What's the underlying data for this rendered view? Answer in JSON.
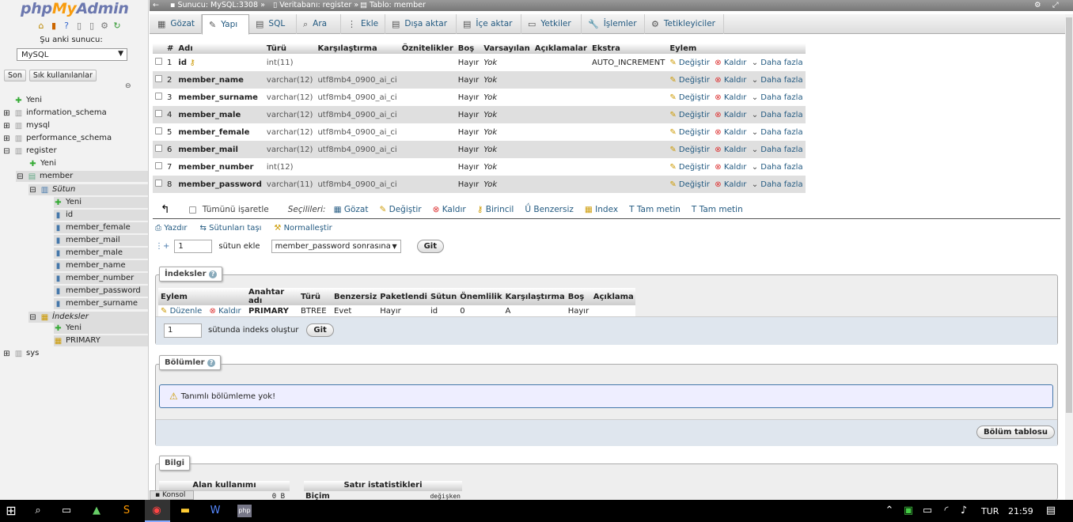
{
  "sidebar": {
    "logo_php": "php",
    "logo_my": "My",
    "logo_admin": "Admin",
    "server_label": "Şu anki sunucu:",
    "server_select": "MySQL",
    "recent_btn": "Son",
    "fav_btn": "Sık kullanılanlar",
    "tree": [
      {
        "label": "Yeni"
      },
      {
        "label": "information_schema"
      },
      {
        "label": "mysql"
      },
      {
        "label": "performance_schema"
      },
      {
        "label": "register"
      },
      {
        "label": "Yeni"
      },
      {
        "label": "member"
      },
      {
        "label": "Sütun"
      },
      {
        "label": "Yeni"
      },
      {
        "label": "id"
      },
      {
        "label": "member_female"
      },
      {
        "label": "member_mail"
      },
      {
        "label": "member_male"
      },
      {
        "label": "member_name"
      },
      {
        "label": "member_number"
      },
      {
        "label": "member_password"
      },
      {
        "label": "member_surname"
      },
      {
        "label": "İndeksler"
      },
      {
        "label": "Yeni"
      },
      {
        "label": "PRIMARY"
      },
      {
        "label": "sys"
      }
    ]
  },
  "breadcrumb": {
    "server": "Sunucu: MySQL:3308",
    "sep1": "»",
    "db": "Veritabanı: register",
    "sep2": "»",
    "table": "Tablo: member"
  },
  "tabs": [
    {
      "label": "Gözat",
      "icon": "browse-icon"
    },
    {
      "label": "Yapı",
      "icon": "structure-icon"
    },
    {
      "label": "SQL",
      "icon": "sql-icon"
    },
    {
      "label": "Ara",
      "icon": "search-icon"
    },
    {
      "label": "Ekle",
      "icon": "insert-icon"
    },
    {
      "label": "Dışa aktar",
      "icon": "export-icon"
    },
    {
      "label": "İçe aktar",
      "icon": "import-icon"
    },
    {
      "label": "Yetkiler",
      "icon": "privileges-icon"
    },
    {
      "label": "İşlemler",
      "icon": "operations-icon"
    },
    {
      "label": "Tetikleyiciler",
      "icon": "triggers-icon"
    }
  ],
  "structure": {
    "headers": [
      "#",
      "Adı",
      "Türü",
      "Karşılaştırma",
      "Öznitelikler",
      "Boş",
      "Varsayılan",
      "Açıklamalar",
      "Ekstra",
      "Eylem"
    ],
    "rows": [
      {
        "num": "1",
        "name": "id",
        "type": "int(11)",
        "collation": "",
        "null": "Hayır",
        "default": "Yok",
        "extra": "AUTO_INCREMENT"
      },
      {
        "num": "2",
        "name": "member_name",
        "type": "varchar(12)",
        "collation": "utf8mb4_0900_ai_ci",
        "null": "Hayır",
        "default": "Yok",
        "extra": ""
      },
      {
        "num": "3",
        "name": "member_surname",
        "type": "varchar(12)",
        "collation": "utf8mb4_0900_ai_ci",
        "null": "Hayır",
        "default": "Yok",
        "extra": ""
      },
      {
        "num": "4",
        "name": "member_male",
        "type": "varchar(12)",
        "collation": "utf8mb4_0900_ai_ci",
        "null": "Hayır",
        "default": "Yok",
        "extra": ""
      },
      {
        "num": "5",
        "name": "member_female",
        "type": "varchar(12)",
        "collation": "utf8mb4_0900_ai_ci",
        "null": "Hayır",
        "default": "Yok",
        "extra": ""
      },
      {
        "num": "6",
        "name": "member_mail",
        "type": "varchar(12)",
        "collation": "utf8mb4_0900_ai_ci",
        "null": "Hayır",
        "default": "Yok",
        "extra": ""
      },
      {
        "num": "7",
        "name": "member_number",
        "type": "int(12)",
        "collation": "",
        "null": "Hayır",
        "default": "Yok",
        "extra": ""
      },
      {
        "num": "8",
        "name": "member_password",
        "type": "varchar(11)",
        "collation": "utf8mb4_0900_ai_ci",
        "null": "Hayır",
        "default": "Yok",
        "extra": ""
      }
    ],
    "action_change": "Değiştir",
    "action_drop": "Kaldır",
    "action_more": "Daha fazla"
  },
  "bulk": {
    "check_all": "Tümünü işaretle",
    "selected": "Seçilileri:",
    "browse": "Gözat",
    "change": "Değiştir",
    "drop": "Kaldır",
    "primary": "Birincil",
    "unique": "Benzersiz",
    "index": "Index",
    "fulltext1": "Tam metin",
    "fulltext2": "Tam metin"
  },
  "tools": {
    "print": "Yazdır",
    "move": "Sütunları taşı",
    "normalize": "Normalleştir"
  },
  "add_col": {
    "count": "1",
    "label": "sütun ekle",
    "position": "member_password sonrasına",
    "go": "Git"
  },
  "indexes": {
    "title": "İndeksler",
    "headers": [
      "Eylem",
      "Anahtar adı",
      "Türü",
      "Benzersiz",
      "Paketlendi",
      "Sütun",
      "Önemlilik",
      "Karşılaştırma",
      "Boş",
      "Açıklama"
    ],
    "row": {
      "edit": "Düzenle",
      "drop": "Kaldır",
      "key": "PRIMARY",
      "type": "BTREE",
      "unique": "Evet",
      "packed": "Hayır",
      "column": "id",
      "cardinality": "0",
      "collation": "A",
      "null": "Hayır",
      "comment": ""
    },
    "create_count": "1",
    "create_label": "sütunda indeks oluştur",
    "go": "Git"
  },
  "partitions": {
    "title": "Bölümler",
    "none": "Tanımlı bölümleme yok!",
    "btn": "Bölüm tablosu"
  },
  "info": {
    "title": "Bilgi",
    "space": "Alan kullanımı",
    "stats": "Satır istatistikleri",
    "space_val": "0 B",
    "format": "Biçim",
    "format_val": "değişken"
  },
  "console": "Konsol",
  "taskbar": {
    "lang": "TUR",
    "time": "21:59"
  }
}
